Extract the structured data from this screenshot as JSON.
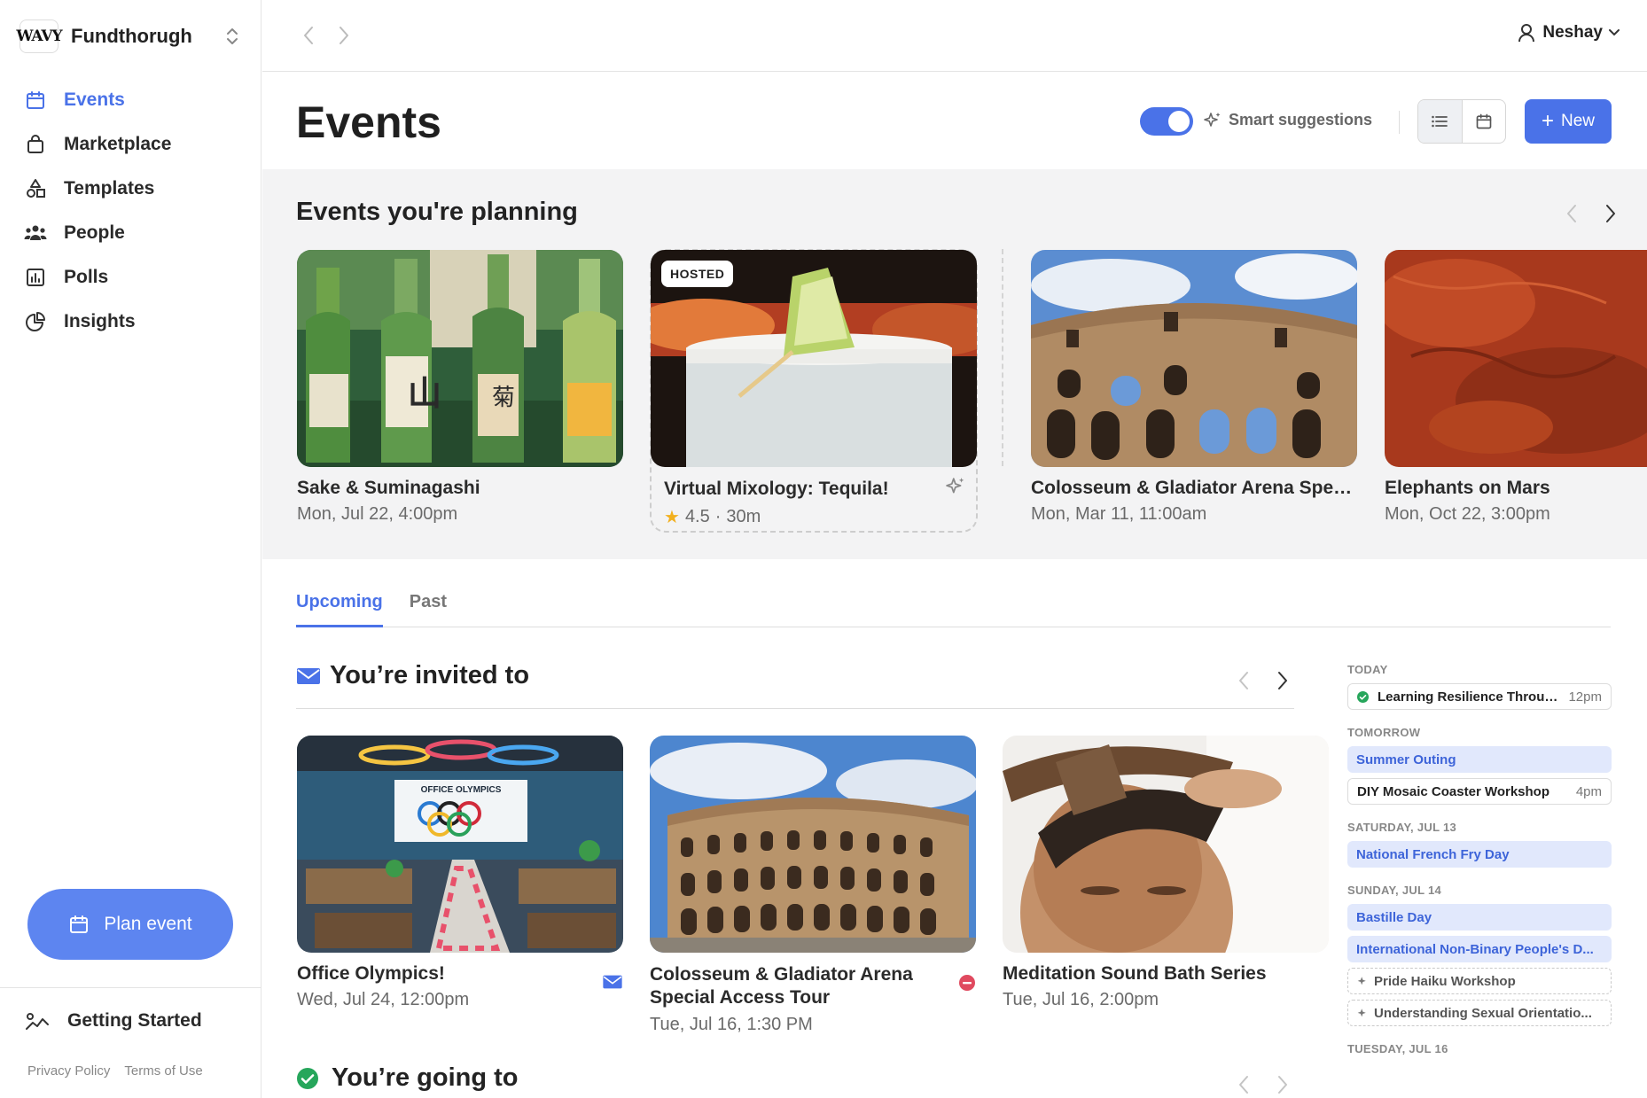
{
  "sidebar": {
    "logo": "WAVY",
    "org_name": "Fundthorugh",
    "nav": [
      {
        "label": "Events",
        "icon": "calendar-icon",
        "active": true
      },
      {
        "label": "Marketplace",
        "icon": "shopping-bag-icon"
      },
      {
        "label": "Templates",
        "icon": "shapes-icon"
      },
      {
        "label": "People",
        "icon": "people-icon"
      },
      {
        "label": "Polls",
        "icon": "bar-chart-icon"
      },
      {
        "label": "Insights",
        "icon": "pie-chart-icon"
      }
    ],
    "plan_event": "Plan event",
    "getting_started": "Getting Started",
    "footer": {
      "privacy": "Privacy Policy",
      "terms": "Terms of Use"
    }
  },
  "topbar": {
    "user_name": "Neshay"
  },
  "header": {
    "title": "Events",
    "smart_suggestions": "Smart suggestions",
    "smart_suggestions_on": true,
    "new_button": "New"
  },
  "planning": {
    "title": "Events you're planning",
    "cards": [
      {
        "title": "Sake & Suminagashi",
        "subtitle": "Mon, Jul 22, 4:00pm"
      },
      {
        "title": "Virtual Mixology: Tequila!",
        "badge": "HOSTED",
        "rating": "4.5",
        "separator": "·",
        "duration": "30m"
      },
      {
        "title": "Colosseum & Gladiator Arena Speci...",
        "subtitle": "Mon, Mar 11, 11:00am"
      },
      {
        "title": "Elephants on Mars",
        "subtitle": "Mon, Oct 22, 3:00pm"
      }
    ]
  },
  "tabs": [
    {
      "label": "Upcoming",
      "active": true
    },
    {
      "label": "Past"
    }
  ],
  "invited": {
    "title": "You’re invited to",
    "cards": [
      {
        "title": "Office Olympics!",
        "subtitle": "Wed, Jul 24, 12:00pm",
        "image_text": "OFFICE OLYMPICS"
      },
      {
        "title": "Colosseum & Gladiator Arena Special Access Tour",
        "subtitle": "Tue, Jul 16, 1:30 PM"
      },
      {
        "title": "Meditation Sound Bath Series",
        "subtitle": "Tue, Jul 16, 2:00pm"
      }
    ]
  },
  "going": {
    "title": "You’re going to"
  },
  "agenda": [
    {
      "day": "TODAY",
      "items": [
        {
          "title": "Learning Resilience Throug...",
          "time": "12pm",
          "style": "white",
          "status": "confirmed"
        }
      ]
    },
    {
      "day": "TOMORROW",
      "items": [
        {
          "title": "Summer Outing",
          "style": "blue"
        },
        {
          "title": "DIY Mosaic Coaster Workshop",
          "time": "4pm",
          "style": "white"
        }
      ]
    },
    {
      "day": "SATURDAY, JUL 13",
      "items": [
        {
          "title": "National French Fry Day",
          "style": "blue"
        }
      ]
    },
    {
      "day": "SUNDAY, JUL 14",
      "items": [
        {
          "title": "Bastille Day",
          "style": "blue"
        },
        {
          "title": "International Non-Binary People's D...",
          "style": "blue"
        },
        {
          "title": "Pride Haiku Workshop",
          "style": "dashed"
        },
        {
          "title": "Understanding Sexual Orientatio...",
          "style": "dashed"
        }
      ]
    },
    {
      "day": "TUESDAY, JUL 16",
      "items": []
    }
  ],
  "colors": {
    "accent": "#4a72e8",
    "success": "#26a65b",
    "declined": "#e04a5f",
    "star": "#f2b01e"
  }
}
